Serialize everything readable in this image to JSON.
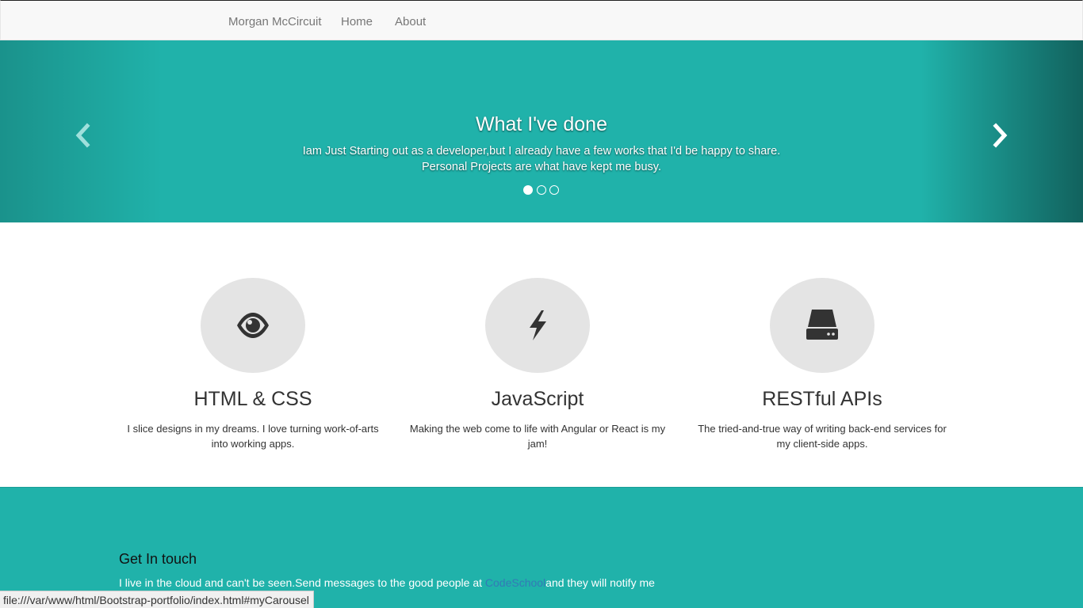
{
  "navbar": {
    "brand": "Morgan McCircuit",
    "items": [
      {
        "label": "Home"
      },
      {
        "label": "About"
      }
    ]
  },
  "carousel": {
    "caption_title": "What I've done",
    "caption_line1": "Iam Just Starting out as a developer,but I already have a few works that I'd be happy to share.",
    "caption_line2": "Personal Projects are what have kept me busy.",
    "prev_icon": "chevron-left-icon",
    "next_icon": "chevron-right-icon",
    "active_slide": 1,
    "slide_count": 3
  },
  "features": [
    {
      "icon": "eye-icon",
      "title": "HTML & CSS",
      "text": "I slice designs in my dreams. I love turning work-of-arts into working apps."
    },
    {
      "icon": "bolt-icon",
      "title": "JavaScript",
      "text": "Making the web come to life with Angular or React is my jam!"
    },
    {
      "icon": "server-icon",
      "title": "RESTful APIs",
      "text": "The tried-and-true way of writing back-end services for my client-side apps."
    }
  ],
  "contact": {
    "heading": "Get In touch",
    "text_before": "I live in the cloud and can't be seen.Send messages to the good people at ",
    "link": "CodeSchool",
    "text_after": "and they will notify me"
  },
  "status_url": "file:///var/www/html/Bootstrap-portfolio/index.html#myCarousel",
  "colors": {
    "accent": "#20b2aa",
    "navbar_bg": "#f8f8f8",
    "icon_circle": "#e4e4e4",
    "link": "#337ab7"
  }
}
